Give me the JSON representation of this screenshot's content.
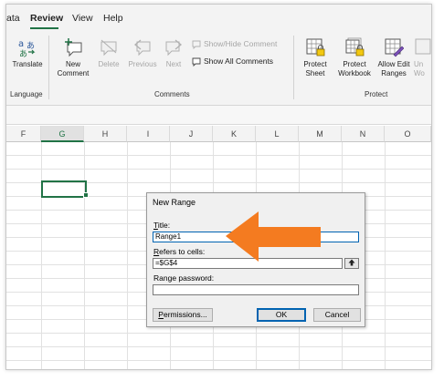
{
  "ribbon_tabs": [
    "ata",
    "Review",
    "View",
    "Help"
  ],
  "active_tab": "Review",
  "language_group": {
    "translate_label": "Translate",
    "group_label": "Language"
  },
  "comments_group": {
    "new_comment_line1": "New",
    "new_comment_line2": "Comment",
    "delete_label": "Delete",
    "previous_label": "Previous",
    "next_label": "Next",
    "show_hide_label": "Show/Hide Comment",
    "show_all_label": "Show All Comments",
    "group_label": "Comments"
  },
  "protect_group": {
    "protect_sheet_line1": "Protect",
    "protect_sheet_line2": "Sheet",
    "protect_workbook_line1": "Protect",
    "protect_workbook_line2": "Workbook",
    "allow_edit_line1": "Allow Edit",
    "allow_edit_line2": "Ranges",
    "unshare_line1": "Un",
    "unshare_line2": "Wo",
    "group_label": "Protect"
  },
  "columns": [
    "F",
    "G",
    "H",
    "I",
    "J",
    "K",
    "L",
    "M",
    "N",
    "O"
  ],
  "selected_column": "G",
  "dialog": {
    "title": "New Range",
    "title_label_u": "T",
    "title_label_rest": "itle:",
    "title_value": "Range1",
    "refers_label_u": "R",
    "refers_label_rest": "efers to cells:",
    "refers_value": "=$G$4",
    "password_label": "Range password:",
    "password_value": "",
    "permissions_u": "P",
    "permissions_rest": "ermissions...",
    "ok_label": "OK",
    "cancel_label": "Cancel"
  },
  "colors": {
    "accent": "#217346",
    "annotation_arrow": "#f47b20",
    "dialog_focus": "#0063b1"
  }
}
